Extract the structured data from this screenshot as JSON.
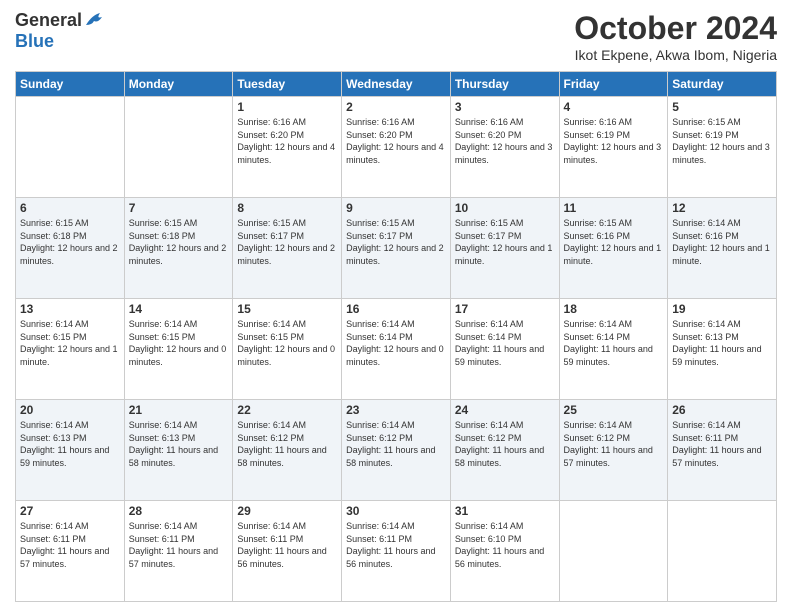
{
  "logo": {
    "general": "General",
    "blue": "Blue"
  },
  "header": {
    "month": "October 2024",
    "location": "Ikot Ekpene, Akwa Ibom, Nigeria"
  },
  "days_of_week": [
    "Sunday",
    "Monday",
    "Tuesday",
    "Wednesday",
    "Thursday",
    "Friday",
    "Saturday"
  ],
  "weeks": [
    [
      {
        "day": "",
        "sunrise": "",
        "sunset": "",
        "daylight": ""
      },
      {
        "day": "",
        "sunrise": "",
        "sunset": "",
        "daylight": ""
      },
      {
        "day": "1",
        "sunrise": "Sunrise: 6:16 AM",
        "sunset": "Sunset: 6:20 PM",
        "daylight": "Daylight: 12 hours and 4 minutes."
      },
      {
        "day": "2",
        "sunrise": "Sunrise: 6:16 AM",
        "sunset": "Sunset: 6:20 PM",
        "daylight": "Daylight: 12 hours and 4 minutes."
      },
      {
        "day": "3",
        "sunrise": "Sunrise: 6:16 AM",
        "sunset": "Sunset: 6:20 PM",
        "daylight": "Daylight: 12 hours and 3 minutes."
      },
      {
        "day": "4",
        "sunrise": "Sunrise: 6:16 AM",
        "sunset": "Sunset: 6:19 PM",
        "daylight": "Daylight: 12 hours and 3 minutes."
      },
      {
        "day": "5",
        "sunrise": "Sunrise: 6:15 AM",
        "sunset": "Sunset: 6:19 PM",
        "daylight": "Daylight: 12 hours and 3 minutes."
      }
    ],
    [
      {
        "day": "6",
        "sunrise": "Sunrise: 6:15 AM",
        "sunset": "Sunset: 6:18 PM",
        "daylight": "Daylight: 12 hours and 2 minutes."
      },
      {
        "day": "7",
        "sunrise": "Sunrise: 6:15 AM",
        "sunset": "Sunset: 6:18 PM",
        "daylight": "Daylight: 12 hours and 2 minutes."
      },
      {
        "day": "8",
        "sunrise": "Sunrise: 6:15 AM",
        "sunset": "Sunset: 6:17 PM",
        "daylight": "Daylight: 12 hours and 2 minutes."
      },
      {
        "day": "9",
        "sunrise": "Sunrise: 6:15 AM",
        "sunset": "Sunset: 6:17 PM",
        "daylight": "Daylight: 12 hours and 2 minutes."
      },
      {
        "day": "10",
        "sunrise": "Sunrise: 6:15 AM",
        "sunset": "Sunset: 6:17 PM",
        "daylight": "Daylight: 12 hours and 1 minute."
      },
      {
        "day": "11",
        "sunrise": "Sunrise: 6:15 AM",
        "sunset": "Sunset: 6:16 PM",
        "daylight": "Daylight: 12 hours and 1 minute."
      },
      {
        "day": "12",
        "sunrise": "Sunrise: 6:14 AM",
        "sunset": "Sunset: 6:16 PM",
        "daylight": "Daylight: 12 hours and 1 minute."
      }
    ],
    [
      {
        "day": "13",
        "sunrise": "Sunrise: 6:14 AM",
        "sunset": "Sunset: 6:15 PM",
        "daylight": "Daylight: 12 hours and 1 minute."
      },
      {
        "day": "14",
        "sunrise": "Sunrise: 6:14 AM",
        "sunset": "Sunset: 6:15 PM",
        "daylight": "Daylight: 12 hours and 0 minutes."
      },
      {
        "day": "15",
        "sunrise": "Sunrise: 6:14 AM",
        "sunset": "Sunset: 6:15 PM",
        "daylight": "Daylight: 12 hours and 0 minutes."
      },
      {
        "day": "16",
        "sunrise": "Sunrise: 6:14 AM",
        "sunset": "Sunset: 6:14 PM",
        "daylight": "Daylight: 12 hours and 0 minutes."
      },
      {
        "day": "17",
        "sunrise": "Sunrise: 6:14 AM",
        "sunset": "Sunset: 6:14 PM",
        "daylight": "Daylight: 11 hours and 59 minutes."
      },
      {
        "day": "18",
        "sunrise": "Sunrise: 6:14 AM",
        "sunset": "Sunset: 6:14 PM",
        "daylight": "Daylight: 11 hours and 59 minutes."
      },
      {
        "day": "19",
        "sunrise": "Sunrise: 6:14 AM",
        "sunset": "Sunset: 6:13 PM",
        "daylight": "Daylight: 11 hours and 59 minutes."
      }
    ],
    [
      {
        "day": "20",
        "sunrise": "Sunrise: 6:14 AM",
        "sunset": "Sunset: 6:13 PM",
        "daylight": "Daylight: 11 hours and 59 minutes."
      },
      {
        "day": "21",
        "sunrise": "Sunrise: 6:14 AM",
        "sunset": "Sunset: 6:13 PM",
        "daylight": "Daylight: 11 hours and 58 minutes."
      },
      {
        "day": "22",
        "sunrise": "Sunrise: 6:14 AM",
        "sunset": "Sunset: 6:12 PM",
        "daylight": "Daylight: 11 hours and 58 minutes."
      },
      {
        "day": "23",
        "sunrise": "Sunrise: 6:14 AM",
        "sunset": "Sunset: 6:12 PM",
        "daylight": "Daylight: 11 hours and 58 minutes."
      },
      {
        "day": "24",
        "sunrise": "Sunrise: 6:14 AM",
        "sunset": "Sunset: 6:12 PM",
        "daylight": "Daylight: 11 hours and 58 minutes."
      },
      {
        "day": "25",
        "sunrise": "Sunrise: 6:14 AM",
        "sunset": "Sunset: 6:12 PM",
        "daylight": "Daylight: 11 hours and 57 minutes."
      },
      {
        "day": "26",
        "sunrise": "Sunrise: 6:14 AM",
        "sunset": "Sunset: 6:11 PM",
        "daylight": "Daylight: 11 hours and 57 minutes."
      }
    ],
    [
      {
        "day": "27",
        "sunrise": "Sunrise: 6:14 AM",
        "sunset": "Sunset: 6:11 PM",
        "daylight": "Daylight: 11 hours and 57 minutes."
      },
      {
        "day": "28",
        "sunrise": "Sunrise: 6:14 AM",
        "sunset": "Sunset: 6:11 PM",
        "daylight": "Daylight: 11 hours and 57 minutes."
      },
      {
        "day": "29",
        "sunrise": "Sunrise: 6:14 AM",
        "sunset": "Sunset: 6:11 PM",
        "daylight": "Daylight: 11 hours and 56 minutes."
      },
      {
        "day": "30",
        "sunrise": "Sunrise: 6:14 AM",
        "sunset": "Sunset: 6:11 PM",
        "daylight": "Daylight: 11 hours and 56 minutes."
      },
      {
        "day": "31",
        "sunrise": "Sunrise: 6:14 AM",
        "sunset": "Sunset: 6:10 PM",
        "daylight": "Daylight: 11 hours and 56 minutes."
      },
      {
        "day": "",
        "sunrise": "",
        "sunset": "",
        "daylight": ""
      },
      {
        "day": "",
        "sunrise": "",
        "sunset": "",
        "daylight": ""
      }
    ]
  ]
}
